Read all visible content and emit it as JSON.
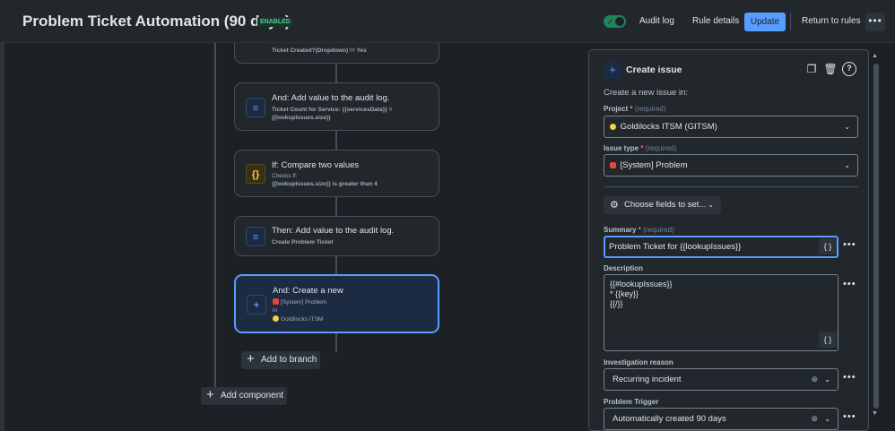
{
  "header": {
    "title": "Problem Ticket Automation (90 days)",
    "status_badge": "ENABLED",
    "audit_log": "Audit log",
    "rule_details": "Rule details",
    "update": "Update",
    "return_to_rules": "Return to rules",
    "more": "•••"
  },
  "flow": {
    "top_card_sub": "Ticket Created?(Dropdown)  != Yes",
    "cards": [
      {
        "title": "And: Add value to the audit log.",
        "sub1": "Ticket Count for Service: {{servicesData}} =",
        "sub2": "{{lookupIssues.size}}",
        "icon": "log-icon"
      },
      {
        "title": "If: Compare two values",
        "sub1": "Checks if:",
        "sub2": "{{lookupIssues.size}} is greater than 4",
        "icon": "braces-icon"
      },
      {
        "title": "Then: Add value to the audit log.",
        "sub1": "Create Problem Ticket",
        "icon": "log-icon"
      },
      {
        "title": "And: Create a new",
        "issue_type": "[System] Problem",
        "in": "in",
        "project": "Goldilocks ITSM",
        "icon": "plus-icon"
      }
    ],
    "add_to_branch": "Add to branch",
    "add_component": "Add component"
  },
  "panel": {
    "title": "Create issue",
    "intro": "Create a new issue in:",
    "project_label": "Project",
    "required": "(required)",
    "project_value": "Goldilocks ITSM (GITSM)",
    "issue_type_label": "Issue type",
    "issue_type_value": "[System] Problem",
    "choose_fields": "Choose fields to set...",
    "summary_label": "Summary",
    "summary_value": "Problem Ticket for {{lookupIssues}}",
    "description_label": "Description",
    "description_value": "{{#lookupIssues}}\n* {{key}}\n{{/}}",
    "investigation_label": "Investigation reason",
    "investigation_value": "Recurring incident",
    "trigger_label": "Problem Trigger",
    "trigger_value": "Automatically created 90 days",
    "braces": "{ }",
    "asterisk": "*"
  },
  "colors": {
    "accent": "#579dff",
    "enabled_green": "#4bce97",
    "background": "#1d2125"
  }
}
